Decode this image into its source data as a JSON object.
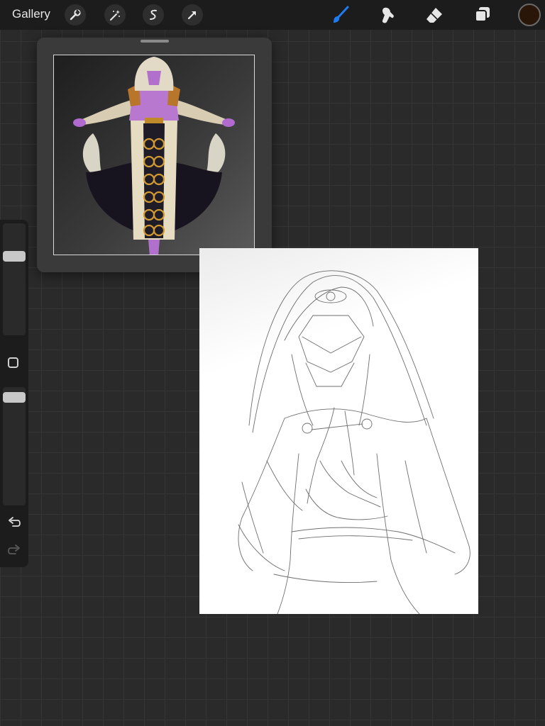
{
  "toolbar": {
    "gallery_label": "Gallery",
    "left_tools": [
      {
        "name": "actions",
        "icon": "wrench-icon"
      },
      {
        "name": "adjustments",
        "icon": "magic-wand-icon"
      },
      {
        "name": "selection",
        "icon": "selection-s-icon"
      },
      {
        "name": "transform",
        "icon": "arrow-cursor-icon"
      }
    ],
    "right_tools": [
      {
        "name": "brush",
        "icon": "brush-icon",
        "active": true
      },
      {
        "name": "smudge",
        "icon": "smudge-icon"
      },
      {
        "name": "eraser",
        "icon": "eraser-icon"
      },
      {
        "name": "layers",
        "icon": "layers-icon"
      }
    ],
    "current_color": "#2a1608",
    "accent_color": "#1e7cf2"
  },
  "sidebar": {
    "brush_size_level": 0.78,
    "opacity_level": 0.95,
    "modify_icon": "square-icon",
    "undo_icon": "undo-icon",
    "redo_icon": "redo-icon"
  },
  "reference": {
    "image": "hooded-robed-character-illustration"
  }
}
